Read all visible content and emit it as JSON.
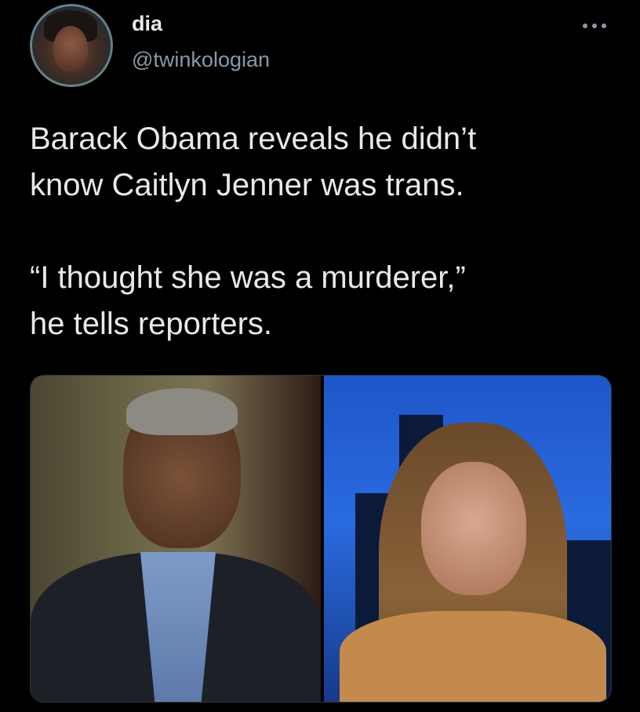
{
  "user": {
    "display_name": "dia",
    "handle": "@twinkologian"
  },
  "tweet": {
    "paragraphs": [
      [
        "Barack Obama reveals he didn’t",
        "know Caitlyn Jenner was trans."
      ],
      [
        "“I thought she was a murderer,”",
        "he tells reporters."
      ]
    ]
  },
  "icons": {
    "more": "more-horizontal-icon"
  },
  "colors": {
    "background": "#000000",
    "text_primary": "#e7e9ea",
    "text_secondary": "#8b98a5"
  }
}
